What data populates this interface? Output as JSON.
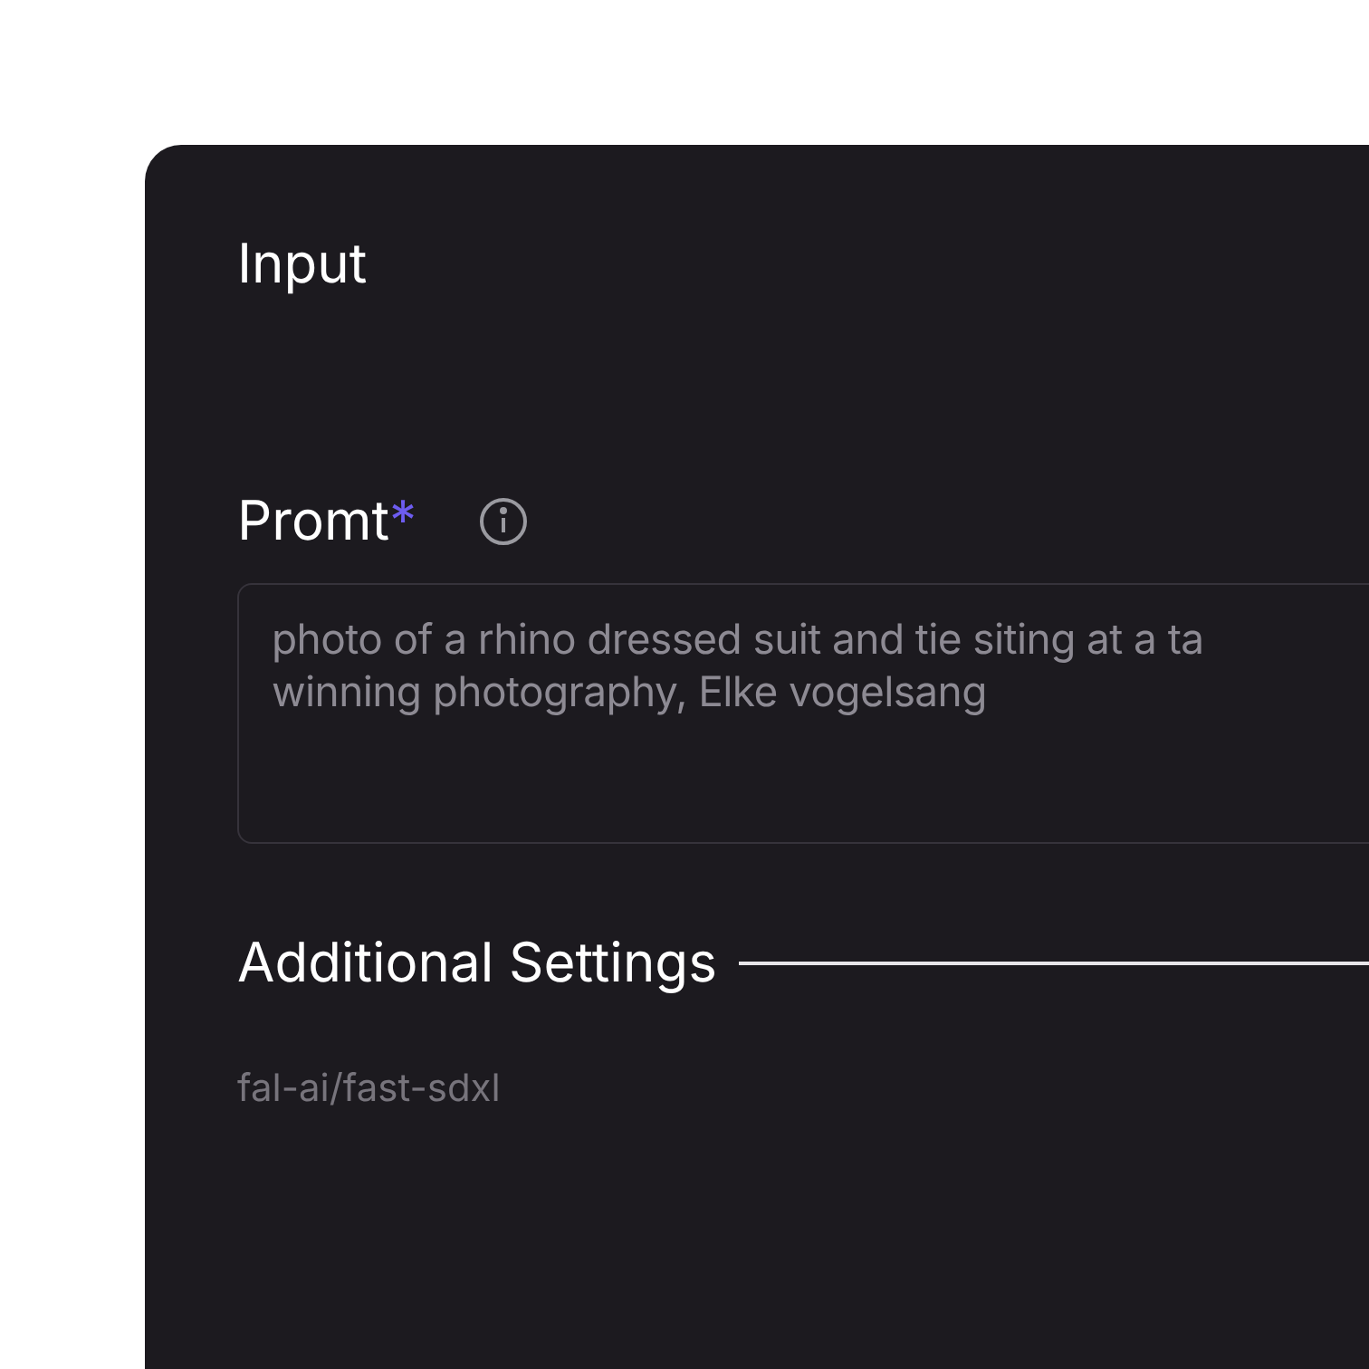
{
  "panel": {
    "title": "Input"
  },
  "prompt": {
    "label": "Promt",
    "required_mark": "*",
    "value_lines": [
      "photo of a rhino dressed suit and tie siting at a ta",
      "winning photography, Elke vogelsang"
    ]
  },
  "additional_settings": {
    "title": "Additional Settings",
    "model": "fal-ai/fast-sdxl"
  }
}
